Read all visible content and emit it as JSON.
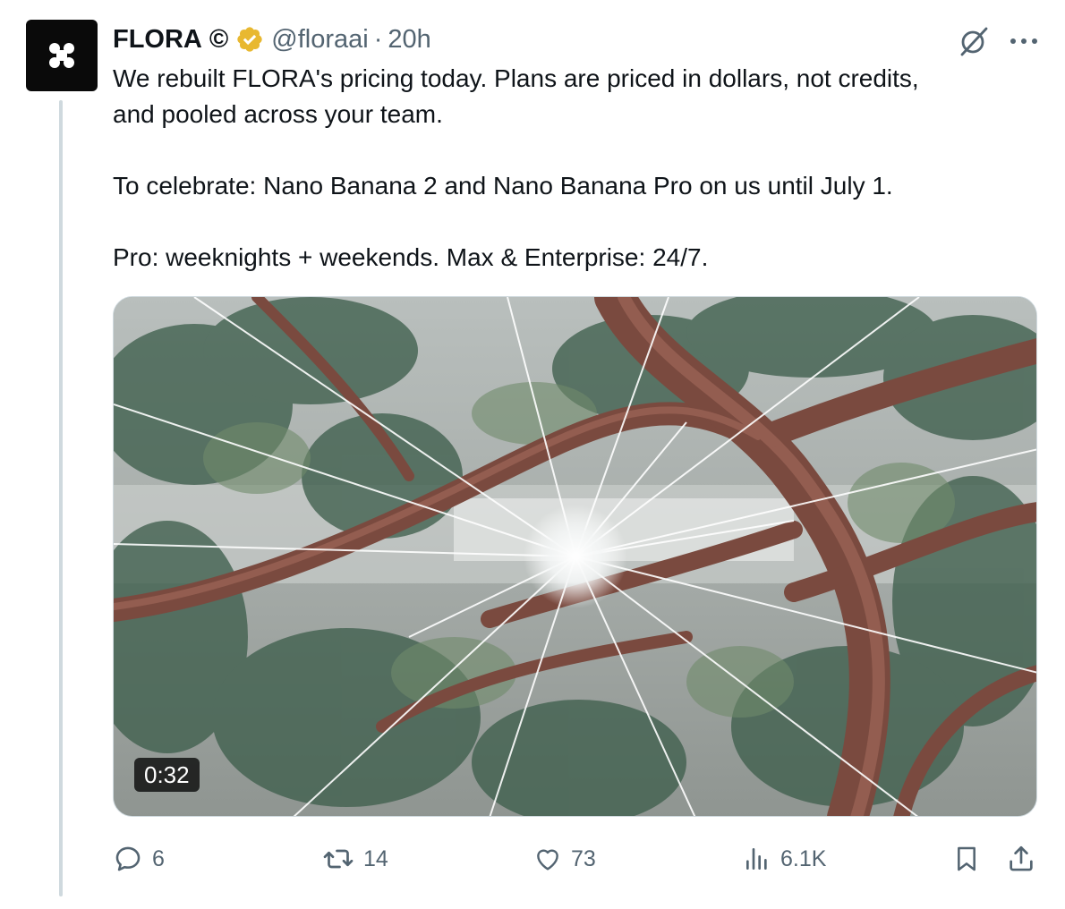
{
  "tweet": {
    "display_name": "FLORA",
    "name_symbol": "©",
    "handle": "@floraai",
    "separator": "·",
    "time": "20h",
    "text_lines": [
      "We rebuilt FLORA's pricing today. Plans are priced in dollars, not credits,",
      "and pooled across your team.",
      "To celebrate: Nano Banana 2 and Nano Banana Pro on us until July 1.",
      "Pro: weeknights + weekends. Max & Enterprise: 24/7."
    ]
  },
  "media": {
    "type": "video",
    "duration": "0:32"
  },
  "actions": {
    "replies": "6",
    "reposts": "14",
    "likes": "73",
    "views": "6.1K"
  },
  "icons": {
    "avatar": "flora-logo-icon",
    "verified": "verified-badge-icon",
    "grok": "grok-icon",
    "more": "more-icon",
    "reply": "reply-icon",
    "repost": "repost-icon",
    "like": "heart-icon",
    "views": "views-icon",
    "bookmark": "bookmark-icon",
    "share": "share-icon"
  },
  "colors": {
    "verified_gold": "#E8B830",
    "text": "#0f1419",
    "secondary": "#536471",
    "thread_line": "#cfd9de"
  }
}
